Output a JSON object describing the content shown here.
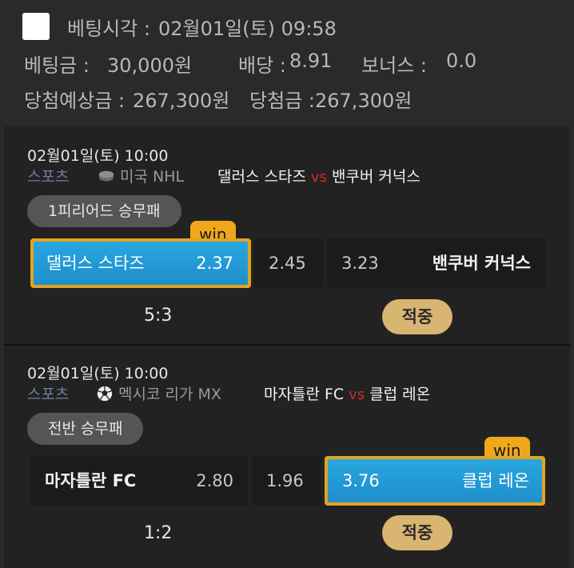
{
  "header": {
    "bet_time_label": "베팅시각 :",
    "bet_time_value": "02월01일(토) 09:58",
    "stake_label": "베팅금 :",
    "stake_value": "30,000원",
    "odds_label": "배당 :",
    "odds_value": "8.91",
    "bonus_label": "보너스 :",
    "bonus_value": "0.0",
    "expected_label": "당첨예상금 :",
    "expected_value": "267,300원",
    "won_label": "당첨금 :",
    "won_value": "267,300원"
  },
  "bets": [
    {
      "date": "02월01일(토) 10:00",
      "sport": "스포츠",
      "sport_icon": "hockey-puck-icon",
      "league": "미국 NHL",
      "home": "댈러스 스타즈",
      "vs": "vs",
      "away": "밴쿠버 커넉스",
      "market": "1피리어드 승무패",
      "home_odds": "2.37",
      "draw_odds": "2.45",
      "away_odds": "3.23",
      "selected": "home",
      "win_label": "win",
      "score": "5:3",
      "result": "적중"
    },
    {
      "date": "02월01일(토) 10:00",
      "sport": "스포츠",
      "sport_icon": "soccer-ball-icon",
      "league": "멕시코 리가 MX",
      "home": "마자틀란 FC",
      "vs": "vs",
      "away": "클럽 레온",
      "market": "전반 승무패",
      "home_odds": "2.80",
      "draw_odds": "1.96",
      "away_odds": "3.76",
      "selected": "away",
      "win_label": "win",
      "score": "1:2",
      "result": "적중"
    }
  ],
  "colors": {
    "selected_blue": "#1e95d2",
    "selected_border": "#e0a520",
    "result_badge": "#d9b572",
    "vs_red": "#d12a2a"
  }
}
